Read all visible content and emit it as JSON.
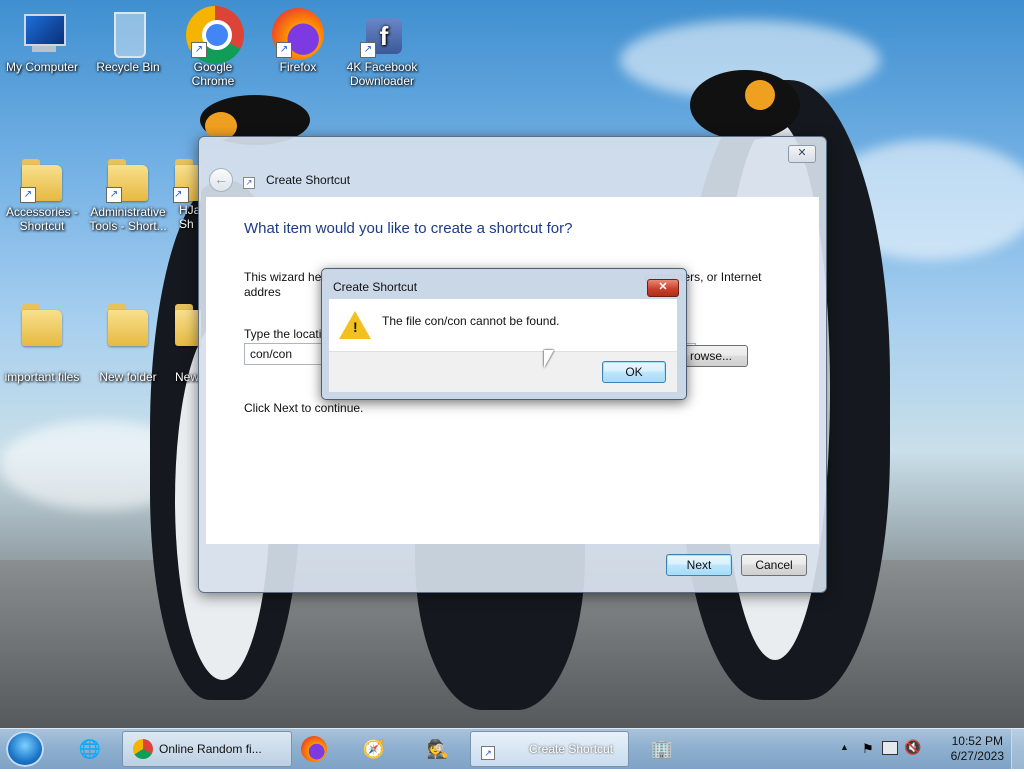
{
  "desktop": {
    "icons": [
      {
        "label": "My Computer"
      },
      {
        "label": "Recycle Bin"
      },
      {
        "label": "Google Chrome"
      },
      {
        "label": "Firefox"
      },
      {
        "label": "4K Facebook Downloader"
      },
      {
        "label": "Accessories - Shortcut"
      },
      {
        "label": "Administrative Tools - Short..."
      },
      {
        "label": "HJa Sh"
      },
      {
        "label": "important files"
      },
      {
        "label": "New folder"
      },
      {
        "label": "New"
      }
    ]
  },
  "wizard": {
    "title": "Create Shortcut",
    "close_glyph": "✕",
    "back_glyph": "←",
    "heading": "What item would you like to create a shortcut for?",
    "description": "This wizard hel                                                                                                computers, or Internet addres",
    "location_label": "Type the locati",
    "location_value": "con/con",
    "browse_label": "rowse...",
    "next_hint": "Click Next to continue.",
    "next_label": "Next",
    "cancel_label": "Cancel"
  },
  "message_box": {
    "title": "Create Shortcut",
    "close_glyph": "✕",
    "text": "The file con/con cannot be found.",
    "ok_label": "OK",
    "icon": "warning-icon"
  },
  "taskbar": {
    "tasks": [
      {
        "label": "Online Random fi...",
        "icon": "chrome-icon"
      },
      {
        "label": "Create Shortcut",
        "icon": "shortcut-icon"
      }
    ],
    "clock_time": "10:52 PM",
    "clock_date": "6/27/2023",
    "tray_up_glyph": "▲"
  },
  "colors": {
    "heading_blue": "#1c3a8a",
    "warning_yellow": "#f3c11d",
    "close_red": "#c9402a"
  }
}
